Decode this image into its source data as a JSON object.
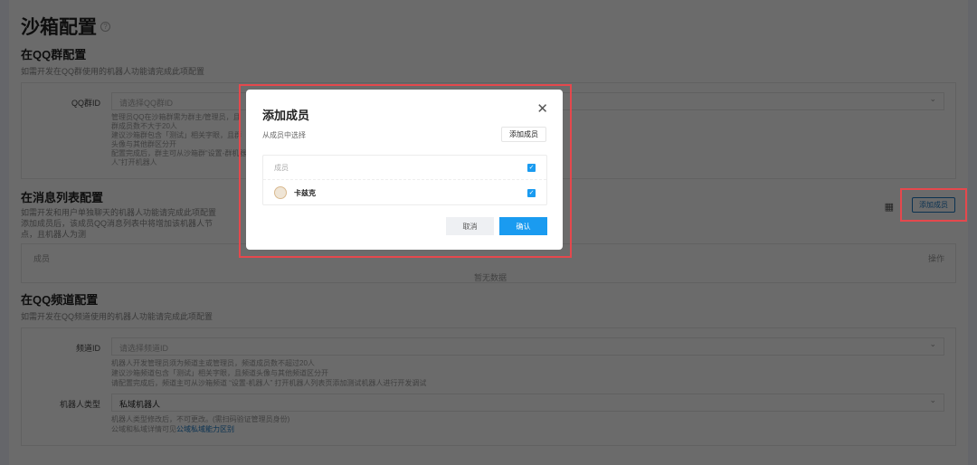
{
  "page": {
    "title": "沙箱配置"
  },
  "group": {
    "title": "在QQ群配置",
    "desc": "如需开发在QQ群使用的机器人功能请完成此项配置",
    "label": "QQ群ID",
    "placeholder": "请选择QQ群ID",
    "hints": [
      "管理员QQ在沙箱群需为群主/管理员，且群成员数不大于20人",
      "建议沙箱群包含「测试」相关字眼，且群头像与其他群区分开",
      "配置完成后，群主可从沙箱群“设置-群机器人”打开机器人"
    ]
  },
  "msg": {
    "title": "在消息列表配置",
    "desc1": "如需开发和用户单独聊天的机器人功能请完成此项配置",
    "desc2": "添加成员后，该成员QQ消息列表中将增加该机器人节点，且机器人为测",
    "col_member": "成员",
    "col_action": "操作",
    "empty": "暂无数据",
    "add_button": "添加成员"
  },
  "channel": {
    "title": "在QQ频道配置",
    "desc": "如需开发在QQ频道使用的机器人功能请完成此项配置",
    "label": "频道ID",
    "placeholder": "请选择频道ID",
    "hints": [
      "机器人开发管理员须为频道主或管理员，频道成员数不超过20人",
      "建议沙箱频道包含「测试」相关字眼，且频道头像与其他频道区分开",
      "请配置完成后，频道主可从沙箱频道 “设置-机器人” 打开机器人列表页添加测试机器人进行开发调试"
    ],
    "type_label": "机器人类型",
    "type_value": "私域机器人",
    "type_hint1": "机器人类型修改后，不可更改。(需扫码验证管理员身份)",
    "type_hint2_prefix": "公域和私域详情可见",
    "type_hint2_link": "公域私域能力区别"
  },
  "modal": {
    "title": "添加成员",
    "subtitle": "从成员中选择",
    "add_button": "添加成员",
    "header": "成员",
    "members": [
      {
        "name": "卡兹克",
        "checked": true
      }
    ],
    "cancel": "取消",
    "confirm": "确认"
  },
  "colors": {
    "primary": "#1a9bf0",
    "highlight": "#e5484d"
  }
}
